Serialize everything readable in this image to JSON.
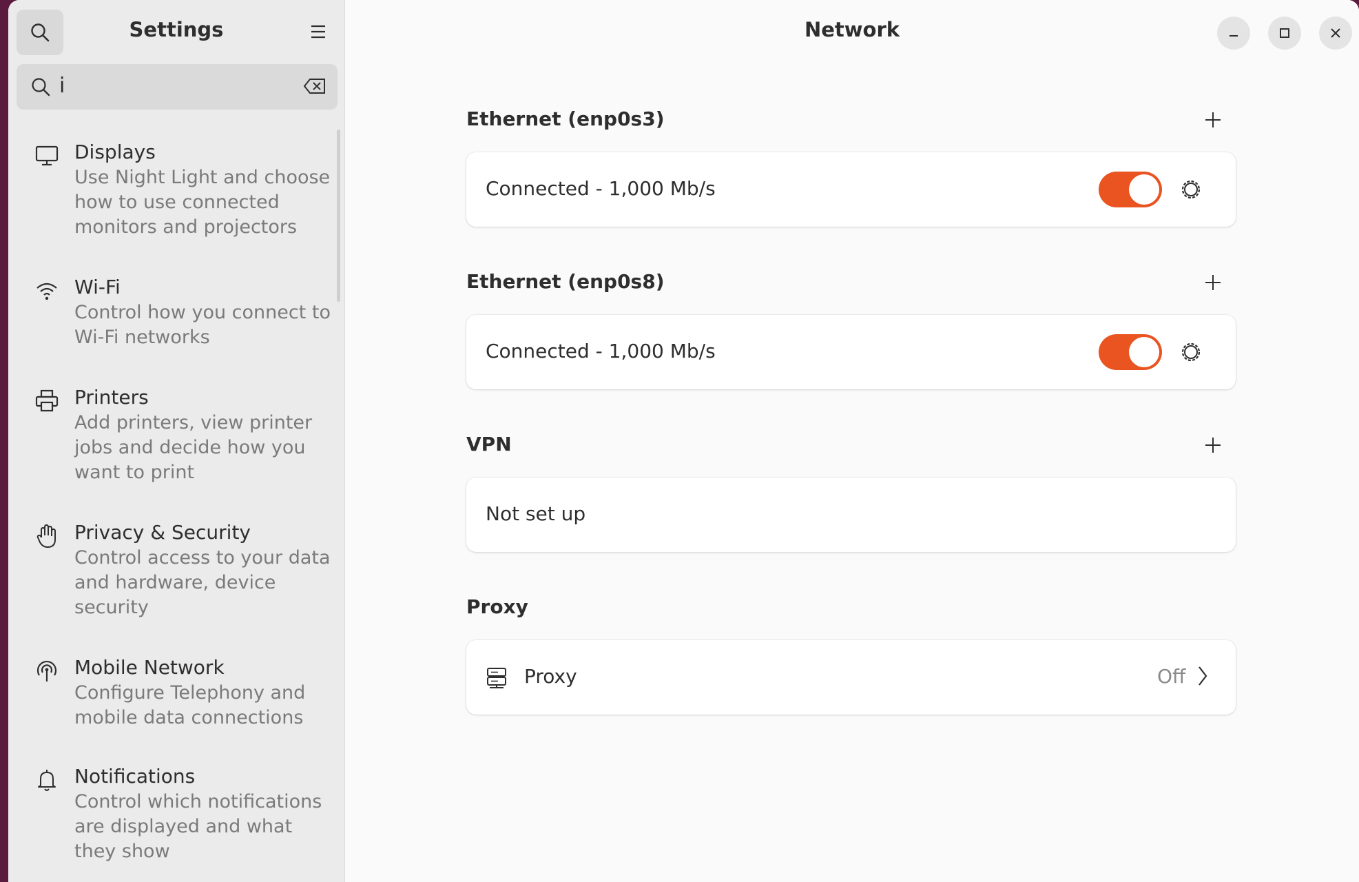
{
  "sidebar": {
    "title": "Settings",
    "search": {
      "value": "i"
    },
    "items": [
      {
        "title": "Displays",
        "desc": "Use Night Light and choose how to use connected monitors and projectors",
        "icon": "display-icon"
      },
      {
        "title": "Wi-Fi",
        "desc": "Control how you connect to Wi-Fi networks",
        "icon": "wifi-icon"
      },
      {
        "title": "Printers",
        "desc": "Add printers, view printer jobs and decide how you want to print",
        "icon": "printer-icon"
      },
      {
        "title": "Privacy & Security",
        "desc": "Control access to your data and hardware, device security",
        "icon": "hand-icon"
      },
      {
        "title": "Mobile Network",
        "desc": "Configure Telephony and mobile data connections",
        "icon": "antenna-icon"
      },
      {
        "title": "Notifications",
        "desc": "Control which notifications are displayed and what they show",
        "icon": "bell-icon"
      }
    ]
  },
  "main": {
    "title": "Network",
    "ethernet1": {
      "title": "Ethernet (enp0s3)",
      "status": "Connected - 1,000 Mb/s",
      "enabled": true
    },
    "ethernet2": {
      "title": "Ethernet (enp0s8)",
      "status": "Connected - 1,000 Mb/s",
      "enabled": true
    },
    "vpn": {
      "title": "VPN",
      "status": "Not set up"
    },
    "proxy": {
      "title": "Proxy",
      "label": "Proxy",
      "value": "Off"
    }
  },
  "colors": {
    "accent": "#e95420",
    "sidebar_bg": "#ebebeb",
    "content_bg": "#fafafa"
  }
}
